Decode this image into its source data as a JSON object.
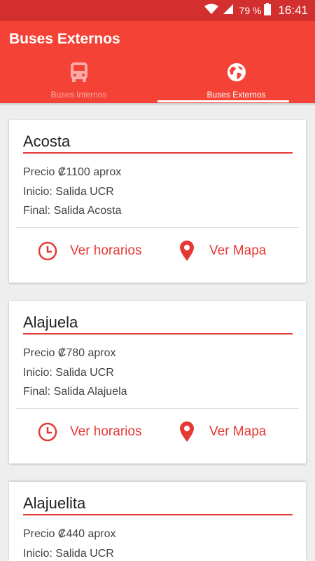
{
  "status_bar": {
    "battery": "79 %",
    "time": "16:41",
    "icons": [
      "wifi-icon",
      "signal-icon",
      "battery-icon"
    ]
  },
  "app_bar": {
    "title": "Buses Externos"
  },
  "tabs": [
    {
      "label": "Buses Internos",
      "icon": "bus-icon",
      "active": false
    },
    {
      "label": "Buses Externos",
      "icon": "globe-icon",
      "active": true
    }
  ],
  "colors": {
    "primary": "#f44336",
    "primary_dark": "#d32f2f",
    "accent": "#e53935"
  },
  "routes": [
    {
      "name": "Acosta",
      "price": "Precio ₡1100 aprox",
      "start": "Inicio: Salida UCR",
      "end": "Final: Salida Acosta",
      "schedule_label": "Ver horarios",
      "map_label": "Ver Mapa"
    },
    {
      "name": "Alajuela",
      "price": "Precio ₡780 aprox",
      "start": "Inicio: Salida UCR",
      "end": "Final: Salida Alajuela",
      "schedule_label": "Ver horarios",
      "map_label": "Ver Mapa"
    },
    {
      "name": "Alajuelita",
      "price": "Precio ₡440 aprox",
      "start": "Inicio: Salida UCR"
    }
  ]
}
